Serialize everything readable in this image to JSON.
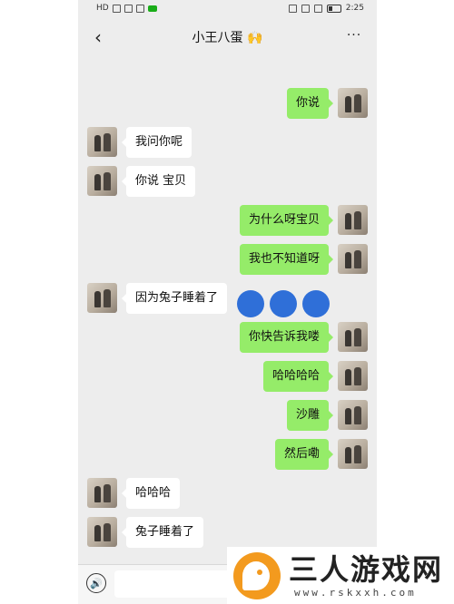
{
  "status_bar": {
    "left_text": "HD",
    "time": "2:25"
  },
  "header": {
    "back_glyph": "‹",
    "title": "小王八蛋 🙌",
    "more_glyph": "···"
  },
  "messages": [
    {
      "side": "out",
      "text": "你说"
    },
    {
      "side": "in",
      "text": "我问你呢"
    },
    {
      "side": "in",
      "text": "你说 宝贝"
    },
    {
      "side": "out",
      "text": "为什么呀宝贝"
    },
    {
      "side": "out",
      "text": "我也不知道呀"
    },
    {
      "side": "in",
      "text": "因为兔子睡着了"
    },
    {
      "side": "out",
      "text": "你快告诉我喽"
    },
    {
      "side": "out",
      "text": "哈哈哈哈"
    },
    {
      "side": "out",
      "text": "沙雕"
    },
    {
      "side": "out",
      "text": "然后嘞"
    },
    {
      "side": "in",
      "text": "哈哈哈"
    },
    {
      "side": "in",
      "text": "兔子睡着了"
    }
  ],
  "input_bar": {
    "voice_glyph": "🔊"
  },
  "watermark": {
    "title": "三人游戏网",
    "url": "www.rskxxh.com"
  },
  "colors": {
    "outgoing_bubble": "#95ec69",
    "incoming_bubble": "#ffffff",
    "chat_background": "#ededed",
    "dot_overlay": "#2f6fd8",
    "watermark_logo": "#f39a1e"
  }
}
